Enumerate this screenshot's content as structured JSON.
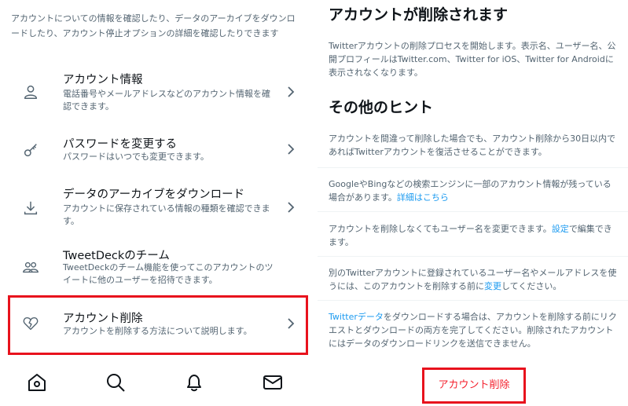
{
  "left": {
    "intro": "アカウントについての情報を確認したり、データのアーカイブをダウンロードしたり、アカウント停止オプションの詳細を確認したりできます",
    "items": [
      {
        "title": "アカウント情報",
        "desc": "電話番号やメールアドレスなどのアカウント情報を確認できます。",
        "icon": "person-icon"
      },
      {
        "title": "パスワードを変更する",
        "desc": "パスワードはいつでも変更できます。",
        "icon": "key-icon"
      },
      {
        "title": "データのアーカイブをダウンロード",
        "desc": "アカウントに保存されている情報の種類を確認できます。",
        "icon": "download-icon"
      },
      {
        "title": "TweetDeckのチーム",
        "desc": "TweetDeckのチーム機能を使ってこのアカウントのツイートに他のユーザーを招待できます。",
        "icon": "people-icon"
      },
      {
        "title": "アカウント削除",
        "desc": "アカウントを削除する方法について説明します。",
        "icon": "broken-heart-icon"
      }
    ],
    "nav": [
      "home-icon",
      "search-icon",
      "bell-icon",
      "mail-icon"
    ]
  },
  "right": {
    "heading1": "アカウントが削除されます",
    "para1": "Twitterアカウントの削除プロセスを開始します。表示名、ユーザー名、公開プロフィールはTwitter.com、Twitter for iOS、Twitter for Androidに表示されなくなります。",
    "heading2": "その他のヒント",
    "tip1": "アカウントを間違って削除した場合でも、アカウント削除から30日以内であればTwitterアカウントを復活させることができます。",
    "tip2_a": "GoogleやBingなどの検索エンジンに一部のアカウント情報が残っている場合があります。",
    "tip2_link": "詳細はこちら",
    "tip3_a": "アカウントを削除しなくてもユーザー名を変更できます。",
    "tip3_link": "設定",
    "tip3_b": "で編集できます。",
    "tip4_a": "別のTwitterアカウントに登録されているユーザー名やメールアドレスを使うには、このアカウントを削除する前に",
    "tip4_link": "変更",
    "tip4_b": "してください。",
    "tip5_link": "Twitterデータ",
    "tip5_b": "をダウンロードする場合は、アカウントを削除する前にリクエストとダウンロードの両方を完了してください。削除されたアカウントにはデータのダウンロードリンクを送信できません。",
    "delete_button": "アカウント削除"
  },
  "colors": {
    "accent_red": "#f4212e",
    "highlight_border": "#e8121d",
    "link_blue": "#1d9bf0",
    "secondary_text": "#536471"
  }
}
